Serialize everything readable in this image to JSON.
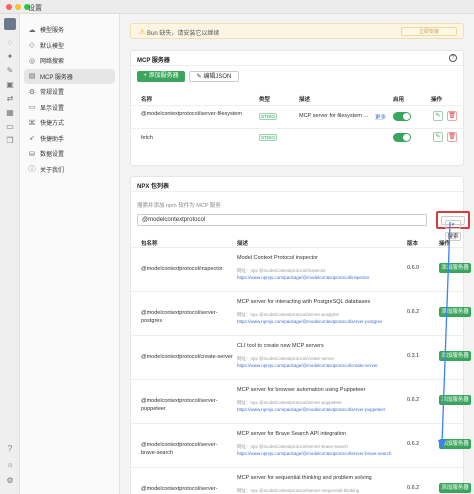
{
  "window": {
    "title": "设置"
  },
  "sidebar": {
    "items": [
      {
        "label": "模型服务",
        "icon": "cloud-icon"
      },
      {
        "label": "默认模型",
        "icon": "cube-icon"
      },
      {
        "label": "网络搜索",
        "icon": "globe-icon"
      },
      {
        "label": "MCP 服务器",
        "icon": "server-icon",
        "active": true
      },
      {
        "label": "常规设置",
        "icon": "gear-icon"
      },
      {
        "label": "显示设置",
        "icon": "monitor-icon"
      },
      {
        "label": "快捷方式",
        "icon": "zap-icon"
      },
      {
        "label": "快捷助手",
        "icon": "rocket-icon"
      },
      {
        "label": "数据设置",
        "icon": "database-icon"
      },
      {
        "label": "关于我们",
        "icon": "info-icon"
      }
    ]
  },
  "banner": {
    "text": "Bun 缺失，请安装它以继续",
    "button": "立即安装"
  },
  "mcp": {
    "title": "MCP 服务器",
    "add_button": "+ 添加服务器",
    "edit_button": "编辑JSON",
    "columns": [
      "名称",
      "类型",
      "描述",
      "启用",
      "操作"
    ],
    "rows": [
      {
        "name": "@modelcontextprotocol/server-filesystem",
        "type": "STDIO",
        "desc": "MCP server for filesystem ...",
        "more": "更多"
      },
      {
        "name": "fetch",
        "type": "STDIO",
        "desc": "",
        "more": ""
      }
    ]
  },
  "npx": {
    "title": "NPX 包列表",
    "hint": "搜索并添加 npm 软件为 MCP 服务",
    "search_value": "@modelcontextprotocol",
    "search_button": "搜索",
    "columns": [
      "包名称",
      "描述",
      "版本",
      "操作"
    ],
    "rows": [
      {
        "name": "@modelcontextprotocol/inspector",
        "desc": "Model Context Protocol inspector",
        "url_label": "网址：",
        "url": "npx @modelcontextprotocol/inspector",
        "url2": "https://www.npmjs.com/package/@modelcontextprotocol/inspector",
        "version": "0.6.0",
        "action": "添加服务器"
      },
      {
        "name": "@modelcontextprotocol/server-postgres",
        "desc": "MCP server for interacting with PostgreSQL databases",
        "url_label": "网址：",
        "url": "npx @modelcontextprotocol/server-postgres",
        "url2": "https://www.npmjs.com/package/@modelcontextprotocol/server-postgres",
        "version": "0.6.2",
        "action": "添加服务器"
      },
      {
        "name": "@modelcontextprotocol/create-server",
        "desc": "CLI tool to create new MCP servers",
        "url_label": "网址：",
        "url": "npx @modelcontextprotocol/create-server",
        "url2": "https://www.npmjs.com/package/@modelcontextprotocol/create-server",
        "version": "0.3.1",
        "action": "添加服务器"
      },
      {
        "name": "@modelcontextprotocol/server-puppeteer",
        "desc": "MCP server for browser automation using Puppeteer",
        "url_label": "网址：",
        "url": "npx @modelcontextprotocol/server-puppeteer",
        "url2": "https://www.npmjs.com/package/@modelcontextprotocol/server-puppeteer",
        "version": "0.6.2",
        "action": "添加服务器"
      },
      {
        "name": "@modelcontextprotocol/server-brave-search",
        "desc": "MCP server for Brave Search API integration",
        "url_label": "网址：",
        "url": "npx @modelcontextprotocol/server-brave-search",
        "url2": "https://www.npmjs.com/package/@modelcontextprotocol/server-brave-search",
        "version": "0.6.2",
        "action": "添加服务器"
      },
      {
        "name": "@modelcontextprotocol/server-",
        "desc": "MCP server for sequential thinking and problem solving",
        "url_label": "网址：",
        "url": "npx @modelcontextprotocol/server-sequential-thinking",
        "url2": "",
        "version": "0.6.2",
        "action": "添加服务器"
      }
    ]
  },
  "colors": {
    "accent": "#3ba55d",
    "highlight": "#d63a3a",
    "arrow": "#3b82f6"
  }
}
